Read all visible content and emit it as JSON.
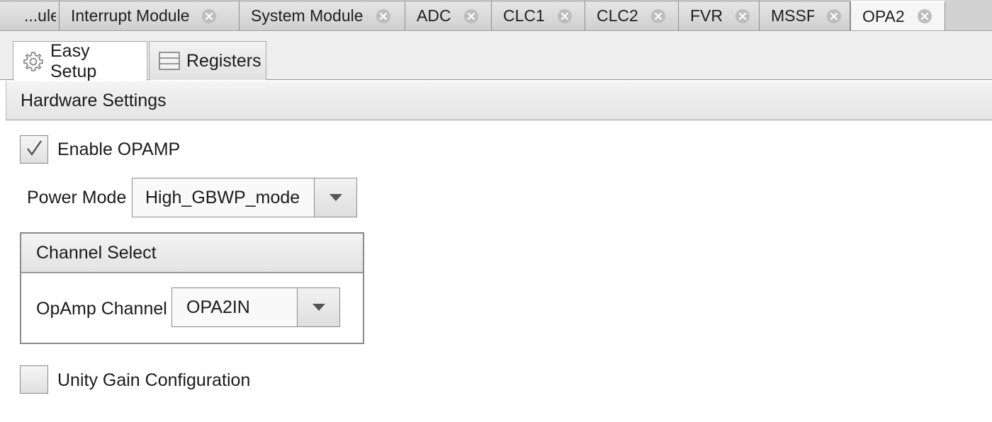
{
  "editor_tabs": [
    {
      "label": "...ule",
      "active": false
    },
    {
      "label": "Interrupt Module",
      "active": false
    },
    {
      "label": "System Module",
      "active": false
    },
    {
      "label": "ADC",
      "active": false
    },
    {
      "label": "CLC1",
      "active": false
    },
    {
      "label": "CLC2",
      "active": false
    },
    {
      "label": "FVR",
      "active": false
    },
    {
      "label": "MSSP",
      "active": false
    },
    {
      "label": "OPA2",
      "active": true
    }
  ],
  "sub_tabs": [
    {
      "label": "Easy Setup",
      "icon": "gear-icon",
      "active": true
    },
    {
      "label": "Registers",
      "icon": "registers-icon",
      "active": false
    }
  ],
  "hardware_settings": {
    "title": "Hardware Settings",
    "enable_opamp": {
      "label": "Enable OPAMP",
      "checked": true
    },
    "power_mode": {
      "label": "Power Mode",
      "value": "High_GBWP_mode"
    },
    "channel_select": {
      "title": "Channel Select",
      "opamp_channel": {
        "label": "OpAmp Channel",
        "value": "OPA2IN"
      }
    },
    "unity_gain": {
      "label": "Unity Gain Configuration",
      "checked": false
    }
  },
  "colors": {
    "tab_strip": "#d2d2d2",
    "active_tab": "#f6f6f6",
    "panel": "#ffffff",
    "border": "#8a8a8a"
  }
}
